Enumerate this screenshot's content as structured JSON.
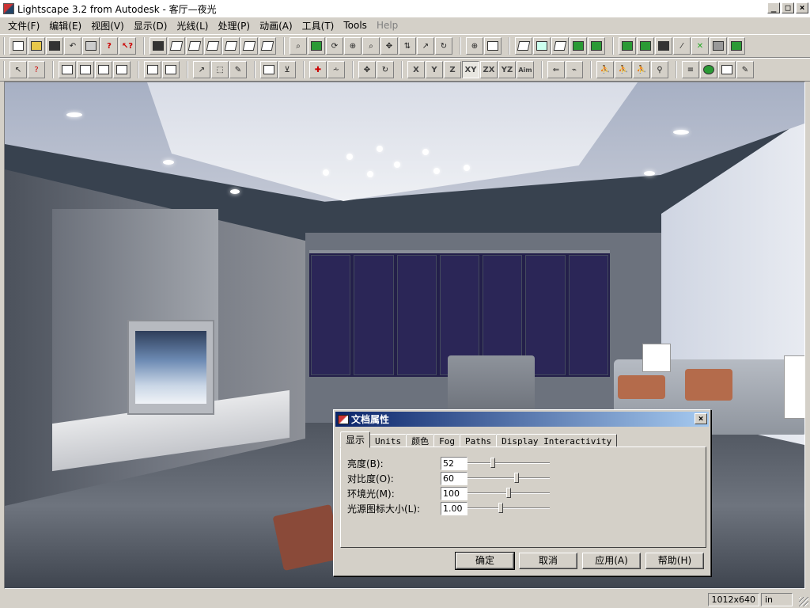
{
  "window": {
    "title": "Lightscape 3.2 from Autodesk - 客厅—夜光",
    "minimize": "_",
    "maximize": "□",
    "close": "×"
  },
  "menu": [
    {
      "label": "文件(F)",
      "name": "menu-file"
    },
    {
      "label": "编辑(E)",
      "name": "menu-edit"
    },
    {
      "label": "视图(V)",
      "name": "menu-view"
    },
    {
      "label": "显示(D)",
      "name": "menu-display"
    },
    {
      "label": "光线(L)",
      "name": "menu-light"
    },
    {
      "label": "处理(P)",
      "name": "menu-process"
    },
    {
      "label": "动画(A)",
      "name": "menu-animation"
    },
    {
      "label": "工具(T)",
      "name": "menu-tools-cn"
    },
    {
      "label": "Tools",
      "name": "menu-tools"
    },
    {
      "label": "Help",
      "name": "menu-help"
    }
  ],
  "toolbar2_axes": [
    "X",
    "Y",
    "Z",
    "XY",
    "ZX",
    "YZ",
    "Aim"
  ],
  "dialog": {
    "title": "文档属性",
    "close": "×",
    "tabs": [
      "显示",
      "Units",
      "颜色",
      "Fog",
      "Paths",
      "Display Interactivity"
    ],
    "active_tab": "显示",
    "properties": [
      {
        "label": "亮度(B):",
        "value": "52",
        "slider_fraction": 0.3
      },
      {
        "label": "对比度(O):",
        "value": "60",
        "slider_fraction": 0.6
      },
      {
        "label": "环境光(M):",
        "value": "100",
        "slider_fraction": 0.5
      },
      {
        "label": "光源图标大小(L):",
        "value": "1.00",
        "slider_fraction": 0.4
      }
    ],
    "buttons": {
      "ok": "确定",
      "cancel": "取消",
      "apply": "应用(A)",
      "help": "帮助(H)"
    }
  },
  "status": {
    "resolution": "1012x640",
    "units": "in"
  },
  "colors": {
    "titlebar_dialog_start": "#0a246a",
    "titlebar_dialog_end": "#a6caf0",
    "face": "#d4d0c8"
  }
}
